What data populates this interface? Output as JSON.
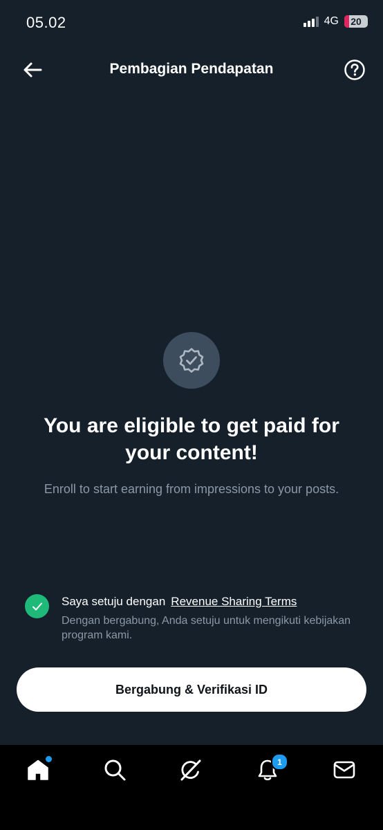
{
  "status_bar": {
    "time": "05.02",
    "network": "4G",
    "battery": "20",
    "battery_level_percent": 20
  },
  "header": {
    "title": "Pembagian Pendapatan",
    "back_icon": "arrow-left-icon",
    "help_icon": "question-circle-icon"
  },
  "hero": {
    "badge_icon": "verified-badge-icon",
    "title": "You are eligible to get paid for your content!",
    "subtitle": "Enroll to start earning from impressions to your posts."
  },
  "agreement": {
    "checked": true,
    "label": "Saya setuju dengan",
    "terms_link": "Revenue Sharing Terms",
    "description": "Dengan bergabung, Anda setuju untuk mengikuti kebijakan program kami."
  },
  "primary_button": {
    "label": "Bergabung & Verifikasi ID"
  },
  "bottom_nav": {
    "items": [
      {
        "icon": "home-icon",
        "active": true,
        "has_dot": true
      },
      {
        "icon": "search-icon"
      },
      {
        "icon": "grok-icon"
      },
      {
        "icon": "bell-icon",
        "badge": "1"
      },
      {
        "icon": "mail-icon"
      }
    ]
  },
  "colors": {
    "background": "#15202b",
    "accent": "#1d9bf0",
    "check_green": "#1fba7a",
    "battery_red": "#e0245e",
    "muted_text": "#8b98a5"
  }
}
